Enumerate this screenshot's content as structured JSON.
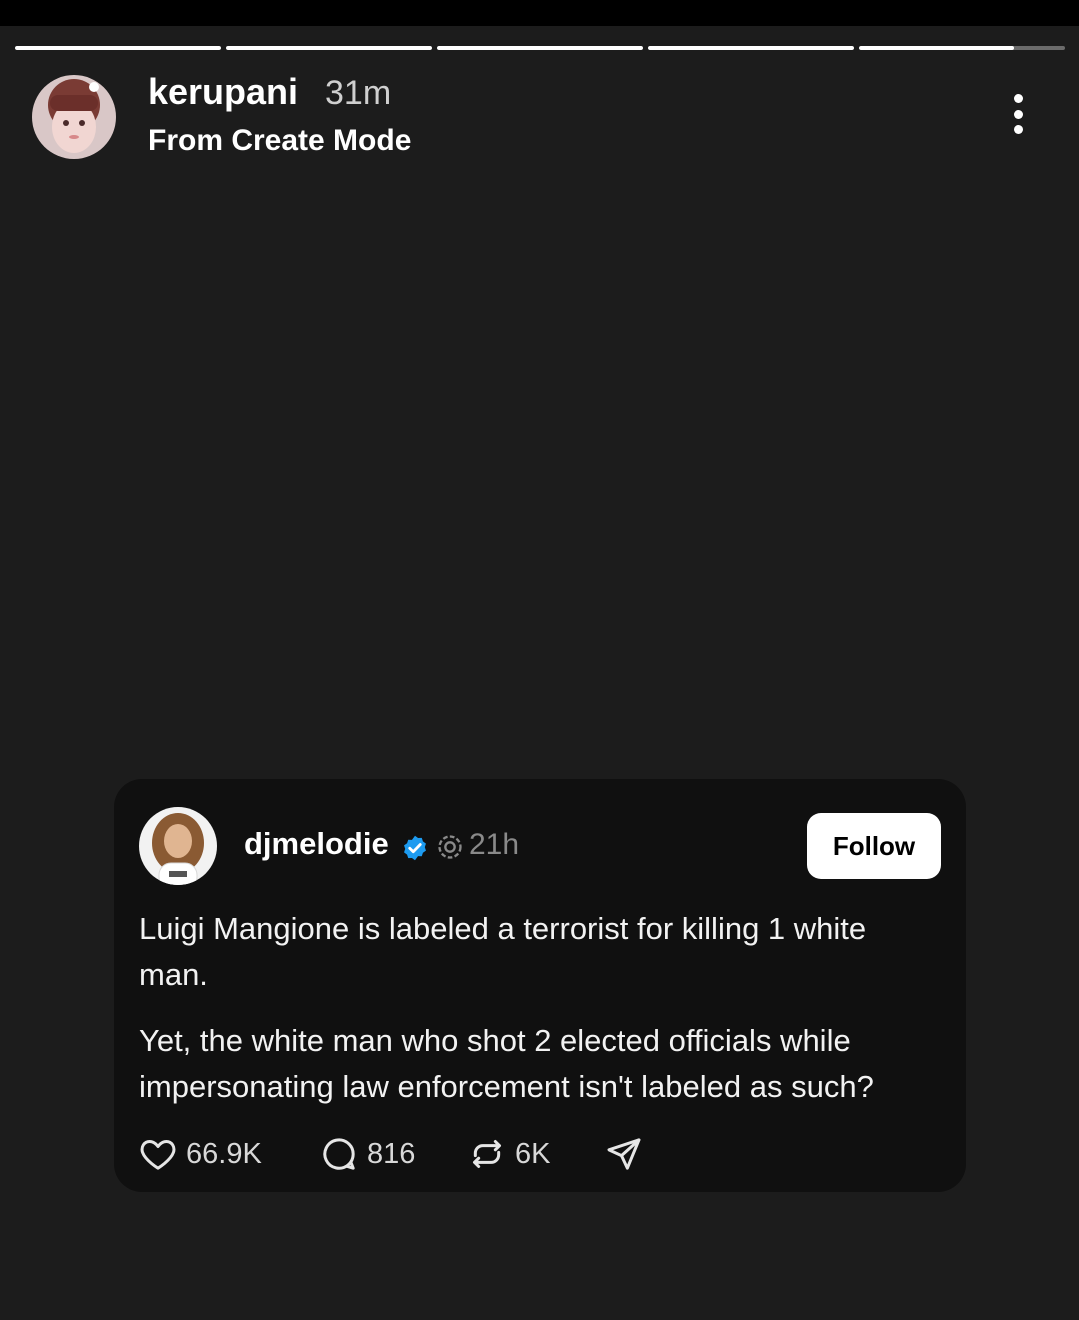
{
  "story": {
    "segments_total": 5,
    "segments_progress": [
      1,
      1,
      1,
      1,
      0.75
    ],
    "author": "kerupani",
    "time": "31m",
    "subtitle": "From Create Mode",
    "menu_icon": "more-vertical-icon"
  },
  "post": {
    "username": "djmelodie",
    "verified": true,
    "time": "21h",
    "follow_label": "Follow",
    "paragraphs": [
      "Luigi Mangione is labeled a terrorist for killing 1 white man.",
      "Yet, the white man who shot 2 elected officials while impersonating law enforcement isn't labeled as such?"
    ],
    "likes": "66.9K",
    "comments": "816",
    "reposts": "6K",
    "icons": {
      "like": "heart-icon",
      "comment": "comment-icon",
      "repost": "repost-icon",
      "share": "send-icon"
    }
  },
  "colors": {
    "background": "#1c1c1c",
    "card": "#101010",
    "verified": "#1d9bf0",
    "follow_button": "#ffffff",
    "muted_text": "#8a8a8a"
  }
}
